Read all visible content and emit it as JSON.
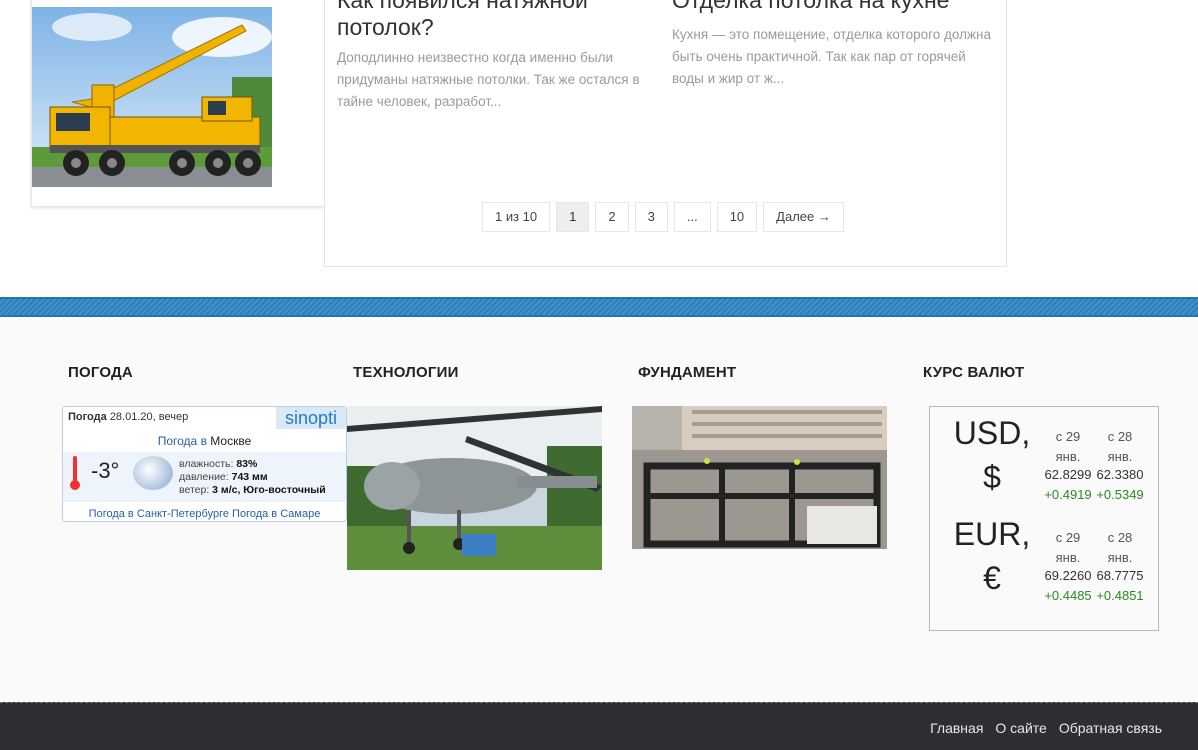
{
  "posts": [
    {
      "title": "Как появился натяжной потолок?",
      "excerpt": "Доподлинно неизвестно когда именно были придуманы натяжные потолки. Так же остался в тайне человек, разработ..."
    },
    {
      "title": "Отделка потолка на кухне",
      "excerpt": "Кухня — это помещение, отделка которого должна быть очень практичной. Так как пар от горячей воды и жир от ж..."
    }
  ],
  "pagination": {
    "info": "1 из 10",
    "pages": [
      "1",
      "2",
      "3",
      "...",
      "10"
    ],
    "current": "1",
    "next": "Далее →"
  },
  "widgets": {
    "weather": {
      "title": "ПОГОДА",
      "header_label": "Погода",
      "header_date": "28.01.20, вечер",
      "logo": "sinopti",
      "city_prefix": "Погода в",
      "city": "Москве",
      "temperature": "-3°",
      "humidity_label": "влажность:",
      "humidity": "83%",
      "pressure_label": "давление:",
      "pressure": "743 мм",
      "wind_label": "ветер:",
      "wind": "3 м/с, Юго-восточный",
      "link_spb": "Погода в Санкт-Петербурге",
      "link_samara": "Погода в Самаре"
    },
    "tech": {
      "title": "ТЕХНОЛОГИИ"
    },
    "foundation": {
      "title": "ФУНДАМЕНТ"
    },
    "currency": {
      "title": "КУРС ВАЛЮТ",
      "rows": [
        {
          "name_line1": "USD,",
          "name_line2": "$",
          "col1_header": "с 29 янв.",
          "col2_header": "с 28 янв.",
          "col1_value": "62.8299",
          "col2_value": "62.3380",
          "col1_delta": "+0.4919",
          "col2_delta": "+0.5349"
        },
        {
          "name_line1": "EUR,",
          "name_line2": "€",
          "col1_header": "с 29 янв.",
          "col2_header": "с 28 янв.",
          "col1_value": "69.2260",
          "col2_value": "68.7775",
          "col1_delta": "+0.4485",
          "col2_delta": "+0.4851"
        }
      ]
    }
  },
  "footer_nav": [
    "Главная",
    "О сайте",
    "Обратная связь"
  ],
  "colors": {
    "stripe": "#3d93cc",
    "bottom_bar": "#2d2f33",
    "delta_positive": "#2a8a22"
  }
}
